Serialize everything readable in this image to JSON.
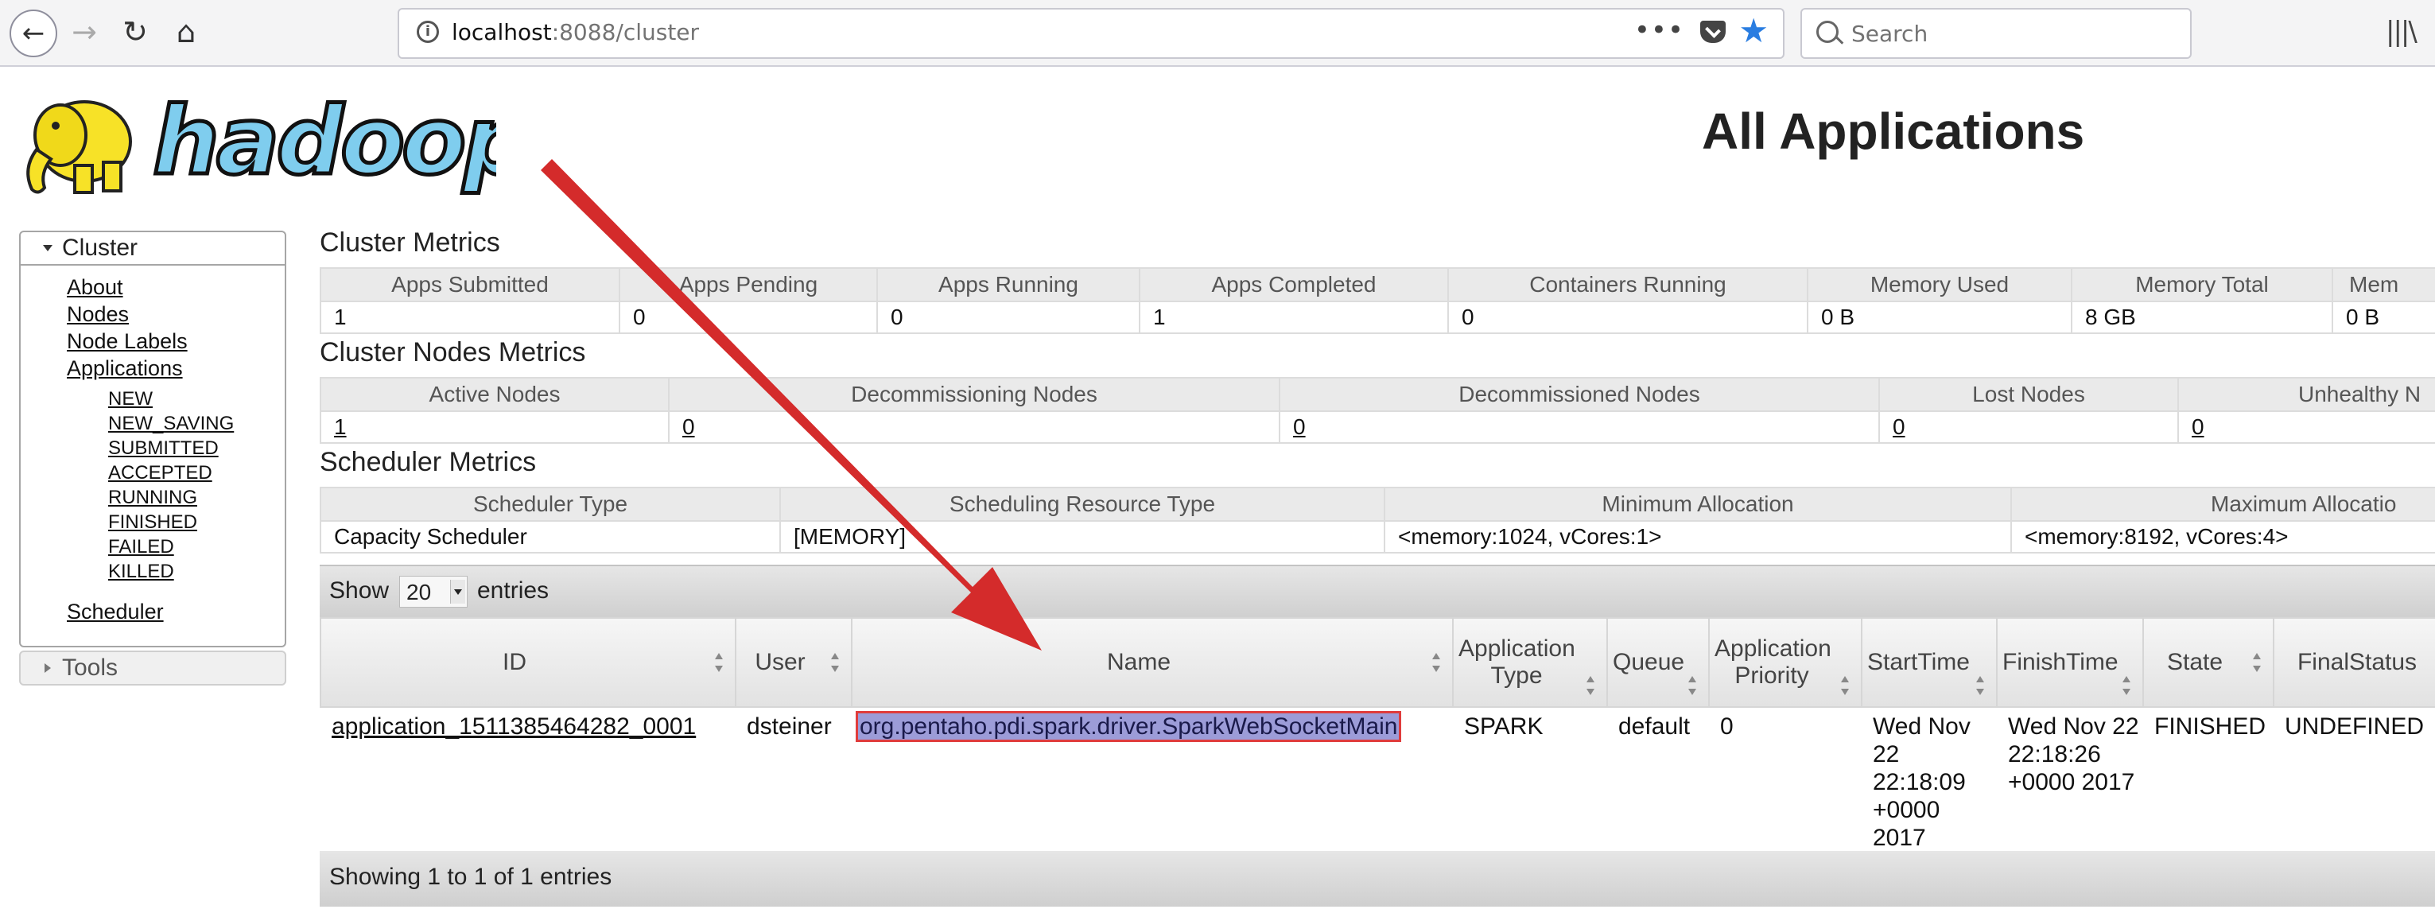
{
  "browser": {
    "url_host": "localhost",
    "url_rest": ":8088/cluster",
    "search_placeholder": "Search",
    "accent_color": "#2a7de1"
  },
  "logo": {
    "text": "hadoop"
  },
  "page": {
    "title": "All Applications"
  },
  "sidebar": {
    "cluster_label": "Cluster",
    "links": [
      "About",
      "Nodes",
      "Node Labels",
      "Applications"
    ],
    "app_states": [
      "NEW",
      "NEW_SAVING",
      "SUBMITTED",
      "ACCEPTED",
      "RUNNING",
      "FINISHED",
      "FAILED",
      "KILLED"
    ],
    "scheduler_label": "Scheduler",
    "tools_label": "Tools"
  },
  "cluster_metrics": {
    "title": "Cluster Metrics",
    "headers": [
      "Apps Submitted",
      "Apps Pending",
      "Apps Running",
      "Apps Completed",
      "Containers Running",
      "Memory Used",
      "Memory Total",
      "Mem"
    ],
    "values": [
      "1",
      "0",
      "0",
      "1",
      "0",
      "0 B",
      "8 GB",
      "0 B"
    ]
  },
  "nodes_metrics": {
    "title": "Cluster Nodes Metrics",
    "headers": [
      "Active Nodes",
      "Decommissioning Nodes",
      "Decommissioned Nodes",
      "Lost Nodes",
      "Unhealthy N"
    ],
    "values": [
      "1",
      "0",
      "0",
      "0",
      "0"
    ]
  },
  "scheduler_metrics": {
    "title": "Scheduler Metrics",
    "headers": [
      "Scheduler Type",
      "Scheduling Resource Type",
      "Minimum Allocation",
      "Maximum Allocatio"
    ],
    "values": [
      "Capacity Scheduler",
      "[MEMORY]",
      "<memory:1024, vCores:1>",
      "<memory:8192, vCores:4>"
    ]
  },
  "apps": {
    "show_label": "Show",
    "entries_value": "20",
    "entries_label": "entries",
    "headers": [
      "ID",
      "User",
      "Name",
      "Application Type",
      "Queue",
      "Application Priority",
      "StartTime",
      "FinishTime",
      "State",
      "FinalStatus"
    ],
    "row": {
      "id": "application_1511385464282_0001",
      "user": "dsteiner",
      "name": "org.pentaho.pdi.spark.driver.SparkWebSocketMain",
      "type": "SPARK",
      "queue": "default",
      "priority": "0",
      "start": "Wed Nov 22 22:18:09 +0000 2017",
      "finish": "Wed Nov 22 22:18:26 +0000 2017",
      "state": "FINISHED",
      "final_status": "UNDEFINED"
    },
    "footer": "Showing 1 to 1 of 1 entries"
  },
  "annotation": {
    "arrow_color": "#d42b2b",
    "highlight_color": "#9c9cd8"
  }
}
